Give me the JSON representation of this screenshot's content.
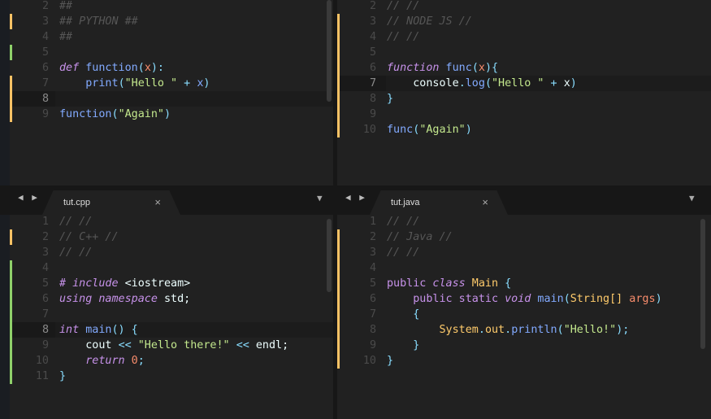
{
  "panes": [
    {
      "id": "python",
      "first": 2,
      "hl": 8,
      "markers": {
        "orange": [
          3,
          7,
          8,
          9,
          10
        ],
        "green": [
          5
        ]
      },
      "lines": [
        [],
        [],
        [
          [
            "##",
            "c"
          ]
        ],
        [
          [
            "## PYTHON ##",
            "c"
          ]
        ],
        [
          [
            "##",
            "c"
          ]
        ],
        [],
        [
          [
            "def",
            "k"
          ],
          [
            " ",
            "t"
          ],
          [
            "function",
            "f"
          ],
          [
            "(",
            "o"
          ],
          [
            "x",
            "p"
          ],
          [
            "):",
            "o"
          ]
        ],
        [
          [
            "    print",
            "f"
          ],
          [
            "(",
            "o"
          ],
          [
            "\"Hello \"",
            "str"
          ],
          [
            " + ",
            "o"
          ],
          [
            "x",
            "f"
          ],
          [
            ")",
            "o"
          ]
        ],
        [],
        [
          [
            "function",
            "f"
          ],
          [
            "(",
            "o"
          ],
          [
            "\"Again\"",
            "str"
          ],
          [
            ")",
            "o"
          ]
        ]
      ]
    },
    {
      "id": "node",
      "first": 2,
      "hl": 7,
      "markers": {
        "orange": [
          3,
          4,
          5,
          6,
          7,
          8,
          9,
          10,
          11
        ],
        "green": []
      },
      "lines": [
        [],
        [],
        [
          [
            "// //",
            "c"
          ]
        ],
        [
          [
            "// NODE JS //",
            "c"
          ]
        ],
        [
          [
            "// //",
            "c"
          ]
        ],
        [],
        [
          [
            "function",
            "k"
          ],
          [
            " func",
            "f"
          ],
          [
            "(",
            "o"
          ],
          [
            "x",
            "p"
          ],
          [
            "){",
            "o"
          ]
        ],
        [
          [
            "    console",
            "t"
          ],
          [
            ".",
            "o"
          ],
          [
            "log",
            "f"
          ],
          [
            "(",
            "o"
          ],
          [
            "\"Hello \"",
            "str"
          ],
          [
            " + ",
            "o"
          ],
          [
            "x",
            "t"
          ],
          [
            ")",
            "o"
          ]
        ],
        [
          [
            "}",
            "o"
          ]
        ],
        [],
        [
          [
            "func",
            "f"
          ],
          [
            "(",
            "o"
          ],
          [
            "\"Again\"",
            "str"
          ],
          [
            ")",
            "o"
          ]
        ]
      ]
    },
    {
      "id": "cpp",
      "first": 1,
      "hl": 8,
      "markers": {
        "orange": [
          2
        ],
        "green": [
          4,
          5,
          6,
          7,
          8,
          9,
          10,
          11,
          12
        ]
      },
      "lines": [
        [],
        [
          [
            "// //",
            "c"
          ]
        ],
        [
          [
            "// C++ //",
            "c"
          ]
        ],
        [
          [
            "// //",
            "c"
          ]
        ],
        [],
        [
          [
            "# include",
            "k"
          ],
          [
            " <iostream>",
            "t"
          ]
        ],
        [
          [
            "using namespace",
            "k"
          ],
          [
            " std;",
            "t"
          ]
        ],
        [],
        [
          [
            "int",
            "k"
          ],
          [
            " main",
            "f"
          ],
          [
            "() {",
            "o"
          ]
        ],
        [
          [
            "    cout ",
            "t"
          ],
          [
            "<<",
            "o"
          ],
          [
            " \"Hello there!\" ",
            "str"
          ],
          [
            "<<",
            "o"
          ],
          [
            " endl;",
            "t"
          ]
        ],
        [
          [
            "    return",
            "k"
          ],
          [
            " 0",
            "n"
          ],
          [
            ";",
            "o"
          ]
        ],
        [
          [
            "}",
            "o"
          ]
        ]
      ]
    },
    {
      "id": "java",
      "first": 1,
      "hl": 11,
      "markers": {
        "orange": [
          2,
          3,
          4,
          5,
          6,
          7,
          8,
          9,
          10,
          11
        ],
        "green": []
      },
      "lines": [
        [],
        [
          [
            "// //",
            "c"
          ]
        ],
        [
          [
            "// Java //",
            "c"
          ]
        ],
        [
          [
            "// //",
            "c"
          ]
        ],
        [],
        [
          [
            "public",
            "s"
          ],
          [
            " class",
            "k"
          ],
          [
            " Main",
            "cls"
          ],
          [
            " {",
            "o"
          ]
        ],
        [
          [
            "    public static",
            "s"
          ],
          [
            " void",
            "k"
          ],
          [
            " main",
            "f"
          ],
          [
            "(",
            "o"
          ],
          [
            "String[]",
            "cls"
          ],
          [
            " args",
            "p"
          ],
          [
            ")",
            "o"
          ]
        ],
        [
          [
            "    {",
            "o"
          ]
        ],
        [
          [
            "        System",
            "cls"
          ],
          [
            ".",
            "o"
          ],
          [
            "out",
            "cls"
          ],
          [
            ".",
            "o"
          ],
          [
            "println",
            "f"
          ],
          [
            "(",
            "o"
          ],
          [
            "\"Hello!\"",
            "str"
          ],
          [
            ");",
            "o"
          ]
        ],
        [
          [
            "    }",
            "o"
          ]
        ],
        [
          [
            "}",
            "o"
          ]
        ]
      ]
    }
  ],
  "tabs": {
    "left": {
      "label": "tut.cpp",
      "close": "×"
    },
    "right": {
      "label": "tut.java",
      "close": "×"
    }
  },
  "icons": {
    "arrows": "◀ ▶",
    "dropdown": "▼"
  },
  "colors": {
    "orange": "#f9c265",
    "green": "#8fd16a"
  }
}
